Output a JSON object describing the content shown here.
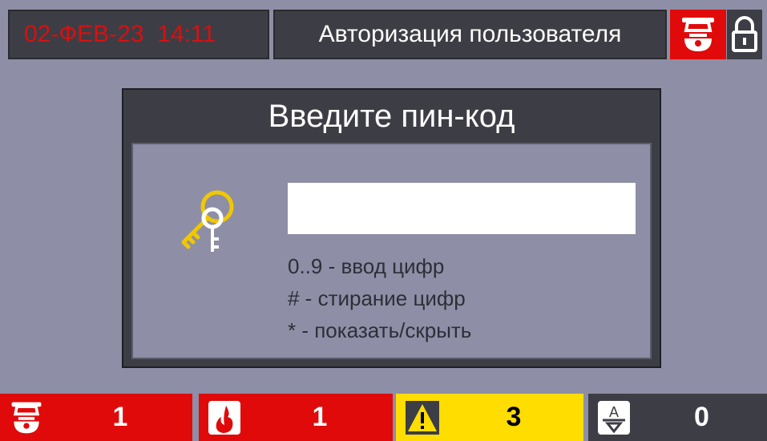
{
  "header": {
    "datetime": "02-ФЕВ-23  14:11",
    "title": "Авторизация пользователя",
    "alarm_icon": "fire-alarm-detector-icon",
    "lock_icon": "lock-icon"
  },
  "dialog": {
    "title": "Введите пин-код",
    "icon": "keys-icon",
    "pin_value": "",
    "hints": [
      "0..9 - ввод цифр",
      "# - стирание цифр",
      "* - показать/скрыть"
    ]
  },
  "status_bar": [
    {
      "icon": "fire-alarm-detector-icon",
      "count": "1",
      "color": "#e00a0a"
    },
    {
      "icon": "fire-flame-icon",
      "count": "1",
      "color": "#e00a0a"
    },
    {
      "icon": "warning-triangle-icon",
      "count": "3",
      "color": "#ffdd00"
    },
    {
      "icon": "service-arrow-icon",
      "count": "0",
      "color": "#3d3d45"
    }
  ],
  "colors": {
    "background": "#8e8ea6",
    "panel": "#3d3d45",
    "alarm": "#e00a0a",
    "warning": "#ffdd00",
    "datetime_text": "#d81010"
  }
}
